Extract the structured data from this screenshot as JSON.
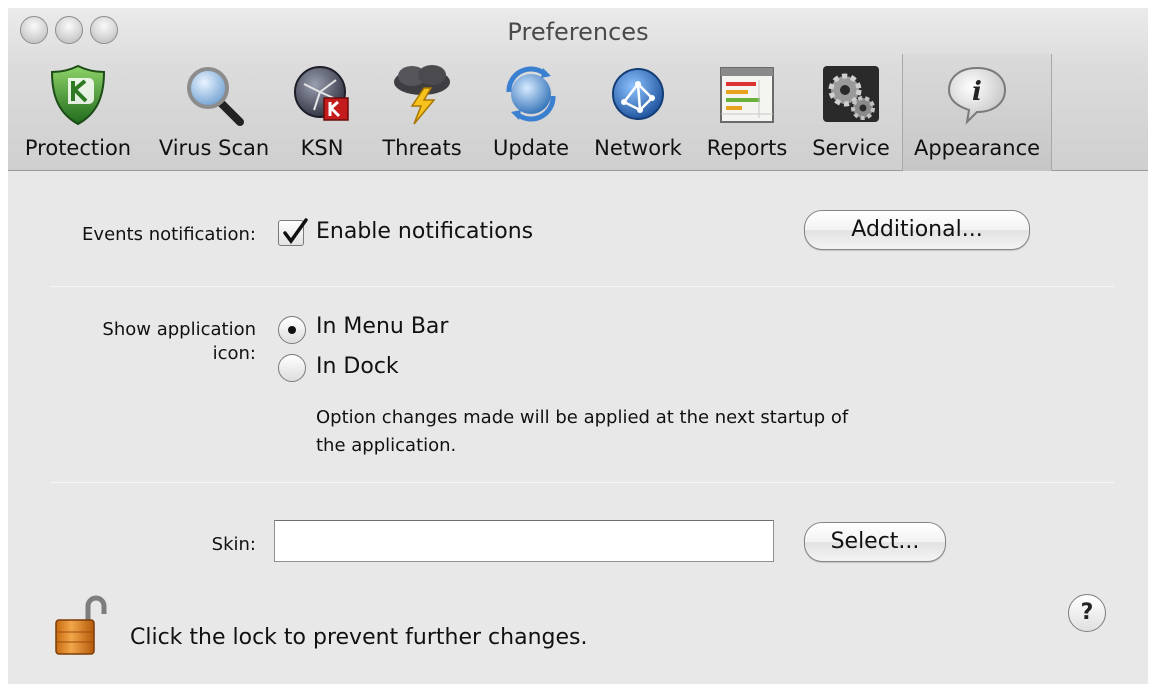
{
  "window": {
    "title": "Preferences"
  },
  "toolbar": {
    "items": [
      {
        "label": "Protection",
        "icon": "shield-icon"
      },
      {
        "label": "Virus Scan",
        "icon": "magnifier-icon"
      },
      {
        "label": "KSN",
        "icon": "ksn-globe-icon"
      },
      {
        "label": "Threats",
        "icon": "storm-cloud-icon"
      },
      {
        "label": "Update",
        "icon": "update-sphere-icon"
      },
      {
        "label": "Network",
        "icon": "network-globe-icon"
      },
      {
        "label": "Reports",
        "icon": "report-chart-icon"
      },
      {
        "label": "Service",
        "icon": "gears-icon"
      },
      {
        "label": "Appearance",
        "icon": "info-bubble-icon"
      }
    ],
    "selected": "Appearance"
  },
  "events": {
    "label": "Events notification:",
    "checkbox_label": "Enable notifications",
    "checked": true,
    "additional_button": "Additional..."
  },
  "app_icon": {
    "label_line1": "Show application",
    "label_line2": "icon:",
    "options": [
      {
        "label": "In Menu Bar",
        "selected": true
      },
      {
        "label": "In Dock",
        "selected": false
      }
    ],
    "note_line1": "Option changes made will be applied at the next startup of",
    "note_line2": "the application."
  },
  "skin": {
    "label": "Skin:",
    "value": "",
    "select_button": "Select..."
  },
  "lock": {
    "text": "Click the lock to prevent further changes."
  },
  "help": {
    "symbol": "?"
  }
}
